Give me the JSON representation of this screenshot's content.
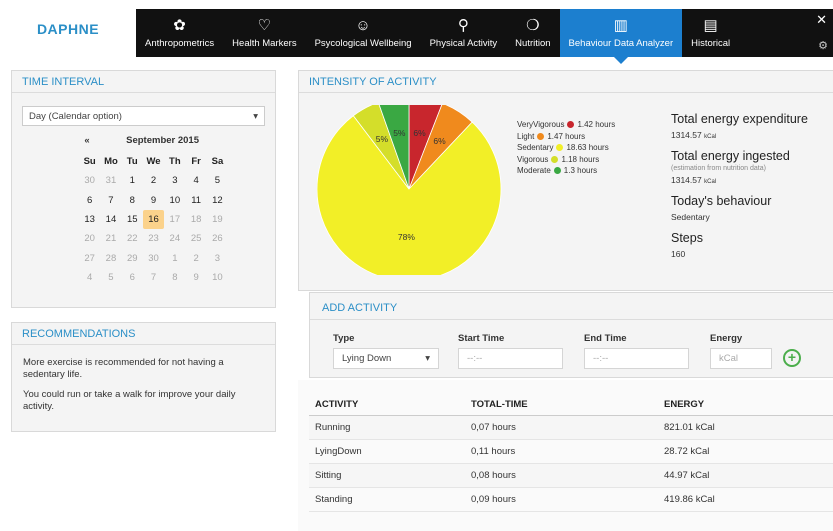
{
  "app": {
    "logo_text": "DAPHNE"
  },
  "nav": {
    "items": [
      {
        "label": "Anthropometrics",
        "icon": "person-icon",
        "glyph": "✿"
      },
      {
        "label": "Health Markers",
        "icon": "heart-icon",
        "glyph": "♡"
      },
      {
        "label": "Psycological Wellbeing",
        "icon": "smiley-icon",
        "glyph": "☺"
      },
      {
        "label": "Physical Activity",
        "icon": "bicycle-icon",
        "glyph": "⚲"
      },
      {
        "label": "Nutrition",
        "icon": "apple-icon",
        "glyph": "❍"
      },
      {
        "label": "Behaviour Data Analyzer",
        "icon": "chart-icon",
        "glyph": "▥"
      },
      {
        "label": "Historical",
        "icon": "document-icon",
        "glyph": "▤"
      }
    ],
    "active_index": 5,
    "close_glyph": "✕",
    "gear_glyph": "⚙"
  },
  "time_interval": {
    "title": "TIME INTERVAL",
    "select_value": "Day (Calendar option)",
    "calendar": {
      "prev": "«",
      "month": "September 2015",
      "dow": [
        "Su",
        "Mo",
        "Tu",
        "We",
        "Th",
        "Fr",
        "Sa"
      ],
      "days": [
        {
          "d": "30",
          "m": true
        },
        {
          "d": "31",
          "m": true
        },
        {
          "d": "1"
        },
        {
          "d": "2"
        },
        {
          "d": "3"
        },
        {
          "d": "4"
        },
        {
          "d": "5"
        },
        {
          "d": "6"
        },
        {
          "d": "7"
        },
        {
          "d": "8"
        },
        {
          "d": "9"
        },
        {
          "d": "10"
        },
        {
          "d": "11"
        },
        {
          "d": "12"
        },
        {
          "d": "13"
        },
        {
          "d": "14"
        },
        {
          "d": "15"
        },
        {
          "d": "16",
          "t": true
        },
        {
          "d": "17",
          "m": true
        },
        {
          "d": "18",
          "m": true
        },
        {
          "d": "19",
          "m": true
        },
        {
          "d": "20",
          "m": true
        },
        {
          "d": "21",
          "m": true
        },
        {
          "d": "22",
          "m": true
        },
        {
          "d": "23",
          "m": true
        },
        {
          "d": "24",
          "m": true
        },
        {
          "d": "25",
          "m": true
        },
        {
          "d": "26",
          "m": true
        },
        {
          "d": "27",
          "m": true
        },
        {
          "d": "28",
          "m": true
        },
        {
          "d": "29",
          "m": true
        },
        {
          "d": "30",
          "m": true
        },
        {
          "d": "1",
          "m": true
        },
        {
          "d": "2",
          "m": true
        },
        {
          "d": "3",
          "m": true
        },
        {
          "d": "4",
          "m": true
        },
        {
          "d": "5",
          "m": true
        },
        {
          "d": "6",
          "m": true
        },
        {
          "d": "7",
          "m": true
        },
        {
          "d": "8",
          "m": true
        },
        {
          "d": "9",
          "m": true
        },
        {
          "d": "10",
          "m": true
        }
      ]
    }
  },
  "recommendations": {
    "title": "RECOMMENDATIONS",
    "lines": [
      "More exercise is recommended for not having a sedentary life.",
      "You could run or take a walk for improve your daily activity."
    ]
  },
  "intensity": {
    "title": "INTENSITY OF ACTIVITY",
    "summary": {
      "energy_expenditure_title": "Total energy expenditure",
      "energy_expenditure_value": "1314.57",
      "energy_expenditure_unit": "kCal",
      "energy_ingested_title": "Total energy ingested",
      "energy_ingested_note": "(estimation from nutrition data)",
      "energy_ingested_value": "1314.57",
      "energy_ingested_unit": "kCal",
      "behaviour_title": "Today's behaviour",
      "behaviour_value": "Sedentary",
      "steps_title": "Steps",
      "steps_value": "160"
    }
  },
  "chart_data": {
    "type": "pie",
    "slices": [
      {
        "name": "VeryVigorous",
        "value": 1.42,
        "label": "6%",
        "legend": "1.42 hours",
        "color": "#c8262d"
      },
      {
        "name": "Light",
        "value": 1.47,
        "label": "6%",
        "legend": "1.47 hours",
        "color": "#f08a1d"
      },
      {
        "name": "Sedentary",
        "value": 18.63,
        "label": "78%",
        "legend": "18.63 hours",
        "color": "#f2ef27"
      },
      {
        "name": "Vigorous",
        "value": 1.18,
        "label": "5%",
        "legend": "1.18 hours",
        "color": "#d4de2a"
      },
      {
        "name": "Moderate",
        "value": 1.3,
        "label": "5%",
        "legend": "1.3 hours",
        "color": "#3aa843"
      }
    ],
    "legend_order": [
      "VeryVigorous",
      "Light",
      "Sedentary",
      "Vigorous",
      "Moderate"
    ]
  },
  "add_activity": {
    "title": "ADD ACTIVITY",
    "type_label": "Type",
    "type_value": "Lying Down",
    "start_label": "Start Time",
    "start_placeholder": "--:--",
    "end_label": "End Time",
    "end_placeholder": "--:--",
    "energy_label": "Energy",
    "energy_placeholder": "kCal",
    "add_glyph": "+"
  },
  "activity_table": {
    "headers": [
      "ACTIVITY",
      "TOTAL-TIME",
      "ENERGY"
    ],
    "rows": [
      [
        "Running",
        "0,07 hours",
        "821.01 kCal"
      ],
      [
        "LyingDown",
        "0,11 hours",
        "28.72 kCal"
      ],
      [
        "Sitting",
        "0,08 hours",
        "44.97 kCal"
      ],
      [
        "Standing",
        "0,09 hours",
        "419.86 kCal"
      ]
    ]
  }
}
